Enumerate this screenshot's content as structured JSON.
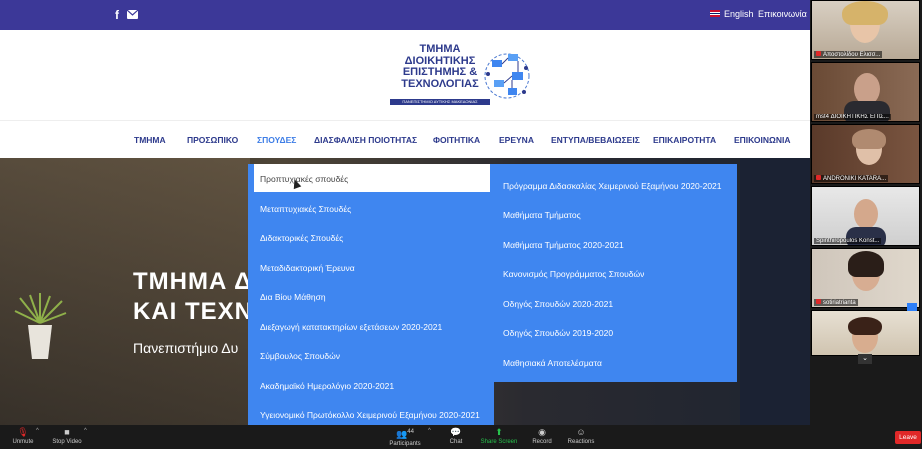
{
  "topbar": {
    "icons": [
      "facebook-icon",
      "mail-icon"
    ],
    "language": "English",
    "contact": "Επικοινωνία"
  },
  "logo": {
    "lines": [
      "ΤΜΗΜΑ",
      "ΔΙΟΙΚΗΤΙΚΗΣ",
      "ΕΠΙΣΤΗΜΗΣ &",
      "ΤΕΧΝΟΛΟΓΙΑΣ"
    ],
    "subtitle": "ΠΑΝΕΠΙΣΤΗΜΙΟ ΔΥΤΙΚΗΣ ΜΑΚΕΔΟΝΙΑΣ"
  },
  "nav": {
    "items": [
      {
        "label": "ΤΜΗΜΑ"
      },
      {
        "label": "ΠΡΟΣΩΠΙΚΟ"
      },
      {
        "label": "ΣΠΟΥΔΕΣ"
      },
      {
        "label": "ΔΙΑΣΦΑΛΙΣΗ ΠΟΙΟΤΗΤΑΣ"
      },
      {
        "label": "ΦΟΙΤΗΤΙΚΑ"
      },
      {
        "label": "ΕΡΕΥΝΑ"
      },
      {
        "label": "ΕΝΤΥΠΑ/ΒΕΒΑΙΩΣΕΙΣ"
      },
      {
        "label": "ΕΠΙΚΑΙΡΟΤΗΤΑ"
      },
      {
        "label": "ΕΠΙΚΟΙΝΩΝΙΑ"
      }
    ],
    "active": "ΣΠΟΥΔΕΣ"
  },
  "hero": {
    "title_line1": "ΤΜΗΜΑ Δ",
    "title_line2": "ΚΑΙ ΤΕΧΝ",
    "subtitle": "Πανεπιστήμιο Δυ"
  },
  "dropdown": {
    "left": [
      "Προπτυχιακές σπουδές",
      "Μεταπτυχιακές Σπουδές",
      "Διδακτορικές Σπουδές",
      "Μεταδιδακτορική Έρευνα",
      "Δια Βίου Μάθηση",
      "Διεξαγωγή κατατακτηρίων εξετάσεων 2020-2021",
      "Σύμβουλος Σπουδών",
      "Ακαδημαϊκό Ημερολόγιο 2020-2021",
      "Υγειονομικό Πρωτόκολλο Χειμερινού Εξαμήνου 2020-2021"
    ],
    "right": [
      "Πρόγραμμα Διδασκαλίας Χειμερινού Εξαμήνου 2020-2021",
      "Μαθήματα Τμήματος",
      "Μαθήματα Τμήματος 2020-2021",
      "Κανονισμός Προγράμματος Σπουδών",
      "Οδηγός Σπουδών 2020-2021",
      "Οδηγός Σπουδών 2019-2020",
      "Μαθησιακά Αποτελέσματα"
    ],
    "hovered": "Προπτυχιακές σπουδές"
  },
  "participants": [
    {
      "name": "Αποστολίδου Ελισσ..."
    },
    {
      "name": "mst4 ΔΙΟΙΚΗΤΙΚΗΣ ΕΠΙΣ..."
    },
    {
      "name": "ANDRONIKI KATARA..."
    },
    {
      "name": "Spinthiropoulos Konst..."
    },
    {
      "name": "sotiriatrianta"
    },
    {
      "name": ""
    }
  ],
  "toolbar": {
    "unmute": "Unmute",
    "stop_video": "Stop Video",
    "participants": "Participants",
    "participants_count": "44",
    "chat": "Chat",
    "share_screen": "Share Screen",
    "record": "Record",
    "reactions": "Reactions",
    "leave": "Leave"
  },
  "colors": {
    "topbar": "#3c3898",
    "nav_text": "#2d3a8c",
    "accent": "#3f86f0",
    "share_green": "#27c24c",
    "leave_red": "#e02828"
  }
}
